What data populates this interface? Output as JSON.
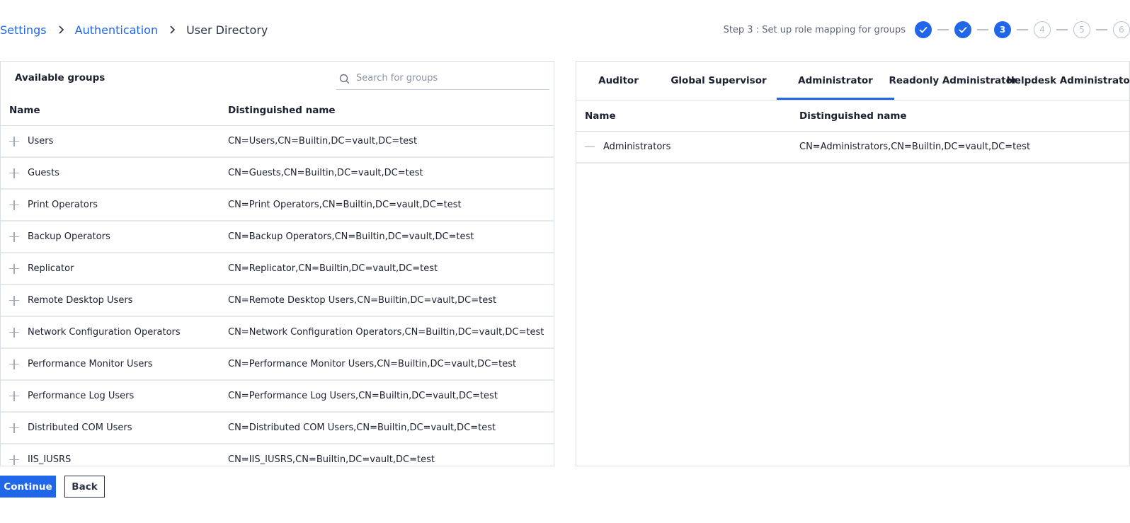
{
  "breadcrumb": {
    "items": [
      "Settings",
      "Authentication"
    ],
    "current": "User Directory"
  },
  "stepper": {
    "text": "Step 3 : Set up role mapping for groups",
    "steps": [
      {
        "label": "",
        "state": "done"
      },
      {
        "label": "",
        "state": "done"
      },
      {
        "label": "3",
        "state": "current"
      },
      {
        "label": "4",
        "state": "pending"
      },
      {
        "label": "5",
        "state": "pending"
      },
      {
        "label": "6",
        "state": "pending"
      }
    ]
  },
  "available": {
    "title": "Available groups",
    "search_placeholder": "Search for groups",
    "columns": {
      "name": "Name",
      "dn": "Distinguished name"
    },
    "rows": [
      {
        "name": "Users",
        "dn": "CN=Users,CN=Builtin,DC=vault,DC=test"
      },
      {
        "name": "Guests",
        "dn": "CN=Guests,CN=Builtin,DC=vault,DC=test"
      },
      {
        "name": "Print Operators",
        "dn": "CN=Print Operators,CN=Builtin,DC=vault,DC=test"
      },
      {
        "name": "Backup Operators",
        "dn": "CN=Backup Operators,CN=Builtin,DC=vault,DC=test"
      },
      {
        "name": "Replicator",
        "dn": "CN=Replicator,CN=Builtin,DC=vault,DC=test"
      },
      {
        "name": "Remote Desktop Users",
        "dn": "CN=Remote Desktop Users,CN=Builtin,DC=vault,DC=test"
      },
      {
        "name": "Network Configuration Operators",
        "dn": "CN=Network Configuration Operators,CN=Builtin,DC=vault,DC=test"
      },
      {
        "name": "Performance Monitor Users",
        "dn": "CN=Performance Monitor Users,CN=Builtin,DC=vault,DC=test"
      },
      {
        "name": "Performance Log Users",
        "dn": "CN=Performance Log Users,CN=Builtin,DC=vault,DC=test"
      },
      {
        "name": "Distributed COM Users",
        "dn": "CN=Distributed COM Users,CN=Builtin,DC=vault,DC=test"
      },
      {
        "name": "IIS_IUSRS",
        "dn": "CN=IIS_IUSRS,CN=Builtin,DC=vault,DC=test"
      }
    ]
  },
  "roles": {
    "tabs": [
      "Auditor",
      "Global Supervisor",
      "Administrator",
      "Readonly Administrator",
      "Helpdesk Administrator"
    ],
    "active_tab": "Administrator",
    "columns": {
      "name": "Name",
      "dn": "Distinguished name"
    },
    "rows": [
      {
        "name": "Administrators",
        "dn": "CN=Administrators,CN=Builtin,DC=vault,DC=test"
      }
    ]
  },
  "actions": {
    "continue": "Continue",
    "back": "Back"
  },
  "colors": {
    "accent": "#1f66e8",
    "border": "#d9dde4",
    "muted": "#b9c1d1"
  }
}
